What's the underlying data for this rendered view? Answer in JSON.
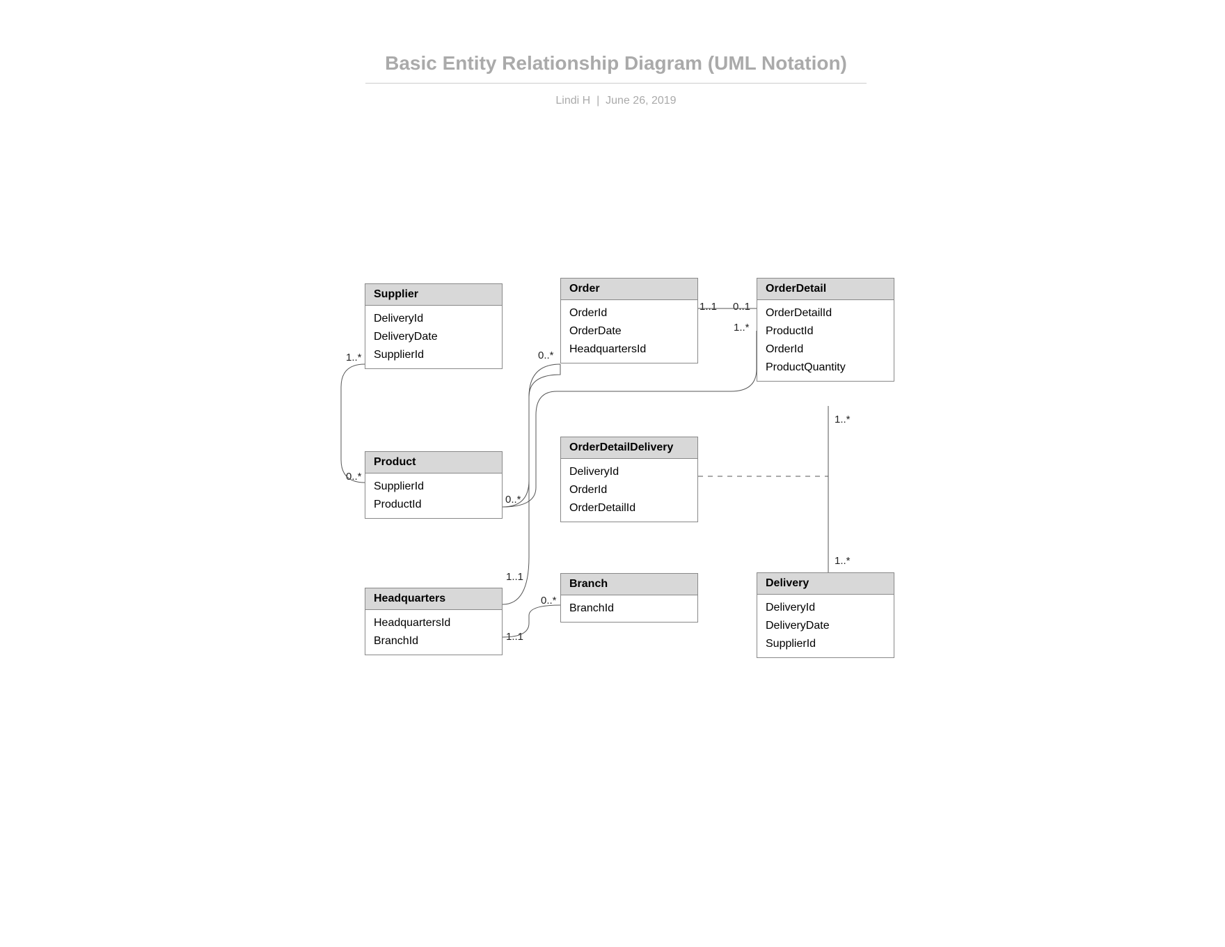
{
  "title": "Basic Entity Relationship Diagram (UML Notation)",
  "author": "Lindi H",
  "date": "June 26, 2019",
  "entities": {
    "supplier": {
      "name": "Supplier",
      "attrs": [
        "DeliveryId",
        "DeliveryDate",
        "SupplierId"
      ]
    },
    "order": {
      "name": "Order",
      "attrs": [
        "OrderId",
        "OrderDate",
        "HeadquartersId"
      ]
    },
    "orderDetail": {
      "name": "OrderDetail",
      "attrs": [
        "OrderDetailId",
        "ProductId",
        "OrderId",
        "ProductQuantity"
      ]
    },
    "product": {
      "name": "Product",
      "attrs": [
        "SupplierId",
        "ProductId"
      ]
    },
    "orderDetailDelivery": {
      "name": "OrderDetailDelivery",
      "attrs": [
        "DeliveryId",
        "OrderId",
        "OrderDetailId"
      ]
    },
    "headquarters": {
      "name": "Headquarters",
      "attrs": [
        "HeadquartersId",
        "BranchId"
      ]
    },
    "branch": {
      "name": "Branch",
      "attrs": [
        "BranchId"
      ]
    },
    "delivery": {
      "name": "Delivery",
      "attrs": [
        "DeliveryId",
        "DeliveryDate",
        "SupplierId"
      ]
    }
  },
  "mult": {
    "supProd1": "1..*",
    "supProd0": "0..*",
    "orderProd0": "0..*",
    "prod0": "0..*",
    "orderOD11": "1..1",
    "orderOD01": "0..1",
    "od1s": "1..*",
    "odDeliv1": "1..*",
    "odDeliv2": "1..*",
    "hq11a": "1..1",
    "hq11b": "1..1",
    "branch0": "0..*"
  }
}
